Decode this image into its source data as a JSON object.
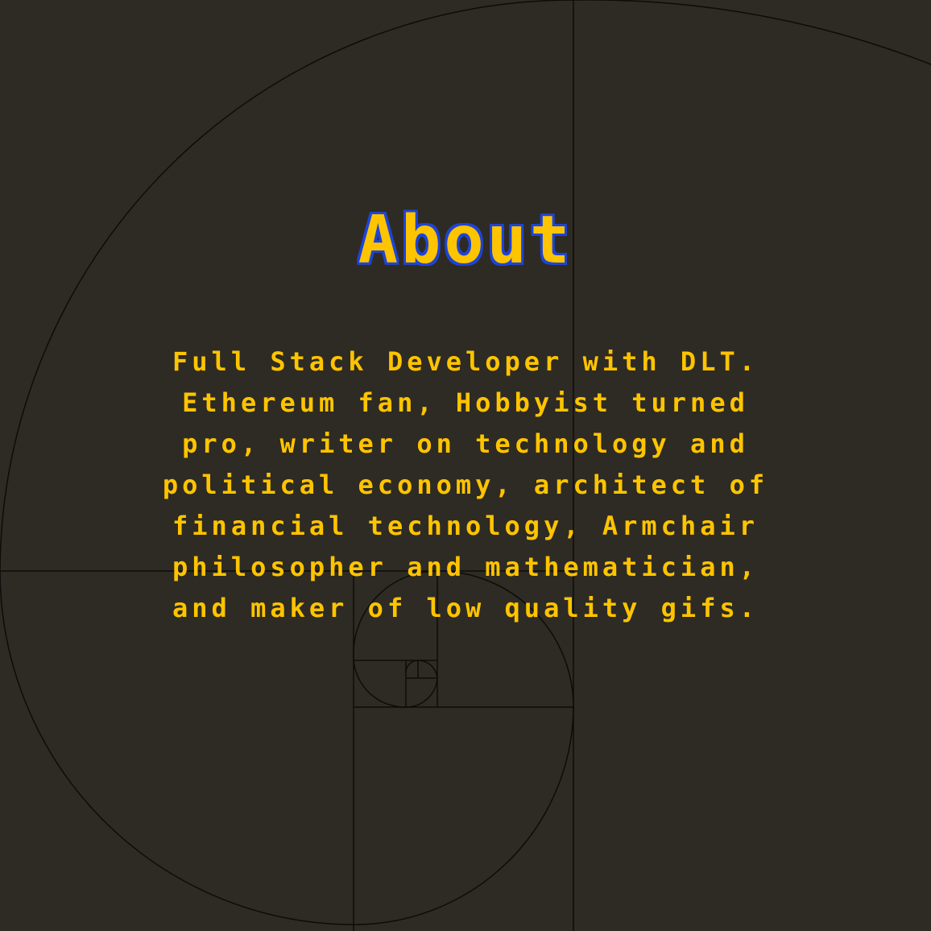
{
  "section": {
    "title": "About",
    "bio": "Full Stack Developer with DLT. Ethereum fan, Hobbyist turned pro, writer on technology and political economy, architect of financial technology, Armchair philosopher and mathematician, and maker of low quality gifs."
  },
  "colors": {
    "background": "#2e2b24",
    "text": "#ffc400",
    "title_outline": "#1e44d6",
    "spiral_lines": "#000000"
  },
  "decoration": {
    "background_graphic": "golden-spiral"
  }
}
